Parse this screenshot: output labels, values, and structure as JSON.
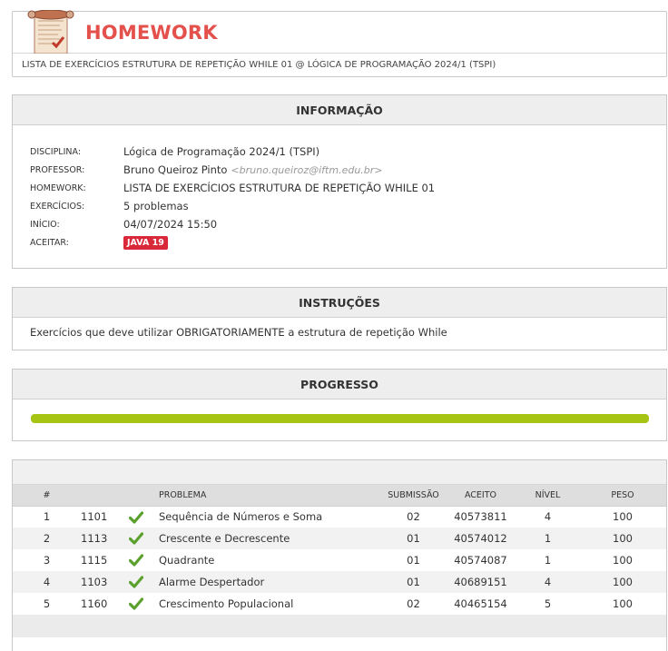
{
  "header": {
    "title": "HOMEWORK",
    "subtitle": "LISTA DE EXERCÍCIOS ESTRUTURA DE REPETIÇÃO WHILE 01 @ LÓGICA DE PROGRAMAÇÃO 2024/1 (TSPI)"
  },
  "info": {
    "heading": "INFORMAÇÃO",
    "rows": [
      {
        "key": "DISCIPLINA:",
        "value": "Lógica de Programação 2024/1 (TSPI)"
      },
      {
        "key": "PROFESSOR:",
        "value": "Bruno Queiroz Pinto",
        "email": "<bruno.queiroz@iftm.edu.br>"
      },
      {
        "key": "HOMEWORK:",
        "value": "LISTA DE EXERCÍCIOS ESTRUTURA DE REPETIÇÃO WHILE 01"
      },
      {
        "key": "EXERCÍCIOS:",
        "value": "5 problemas"
      },
      {
        "key": "INÍCIO:",
        "value": "04/07/2024 15:50"
      },
      {
        "key": "ACEITAR:",
        "badge": "JAVA 19"
      }
    ]
  },
  "instructions": {
    "heading": "INSTRUÇÕES",
    "text": "Exercícios que deve utilizar OBRIGATORIAMENTE a estrutura de repetição While"
  },
  "progress": {
    "heading": "PROGRESSO",
    "percent": 100,
    "color": "#a5c414"
  },
  "table": {
    "columns": [
      "#",
      "PROBLEMA",
      "SUBMISSÃO",
      "ACEITO",
      "NÍVEL",
      "PESO"
    ],
    "rows": [
      {
        "n": "1",
        "id": "1101",
        "name": "Sequência de Números e Soma",
        "sub": "02",
        "acc": "40573811",
        "level": "4",
        "weight": "100"
      },
      {
        "n": "2",
        "id": "1113",
        "name": "Crescente e Decrescente",
        "sub": "01",
        "acc": "40574012",
        "level": "1",
        "weight": "100"
      },
      {
        "n": "3",
        "id": "1115",
        "name": "Quadrante",
        "sub": "01",
        "acc": "40574087",
        "level": "1",
        "weight": "100"
      },
      {
        "n": "4",
        "id": "1103",
        "name": "Alarme Despertador",
        "sub": "01",
        "acc": "40689151",
        "level": "4",
        "weight": "100"
      },
      {
        "n": "5",
        "id": "1160",
        "name": "Crescimento Populacional",
        "sub": "02",
        "acc": "40465154",
        "level": "5",
        "weight": "100"
      }
    ],
    "status_icon": "check-icon",
    "check_color": "#5aa02c"
  },
  "colors": {
    "title_red": "#e4504b",
    "badge_red": "#d9283a",
    "progress_green": "#a5c414"
  }
}
